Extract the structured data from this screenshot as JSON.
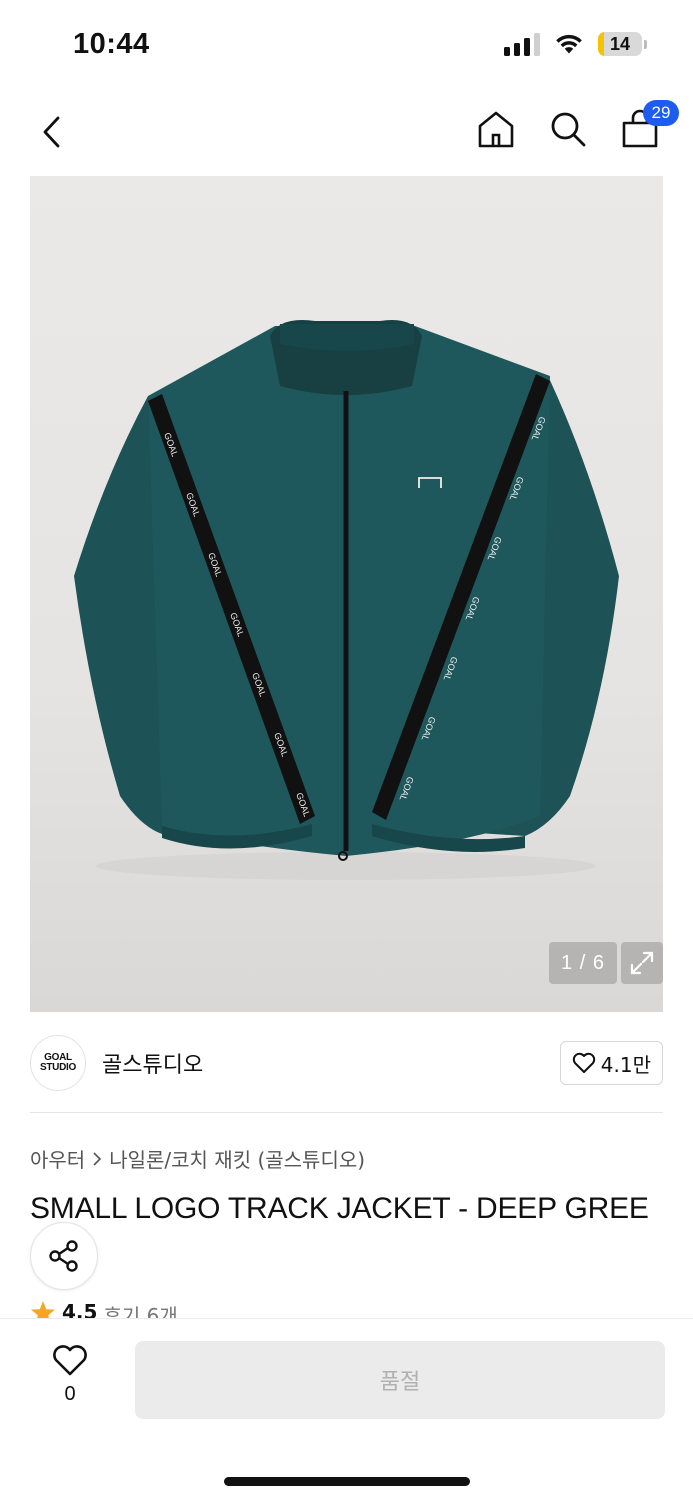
{
  "status_bar": {
    "time": "10:44",
    "battery_level": "14",
    "battery_fraction": 0.14,
    "battery_color": "#f5c400"
  },
  "nav": {
    "back_icon": "chevron-left-icon",
    "home_icon": "home-icon",
    "search_icon": "search-icon",
    "cart_icon": "shopping-bag-icon",
    "cart_count": "29",
    "badge_color": "#1e5bf0"
  },
  "product_image": {
    "counter": "1 / 6",
    "expand_icon": "expand-icon",
    "jacket_color": "#1d5256"
  },
  "brand": {
    "logo_line1": "GOAL",
    "logo_line2": "STUDIO",
    "name": "골스튜디오",
    "like_count": "4.1만"
  },
  "product": {
    "breadcrumb": [
      "아우터",
      "나일론/코치 재킷 (골스튜디오)"
    ],
    "title": "SMALL LOGO TRACK JACKET - DEEP GREE",
    "share_icon": "share-icon",
    "rating": "4.5",
    "review_text": "후기 6개"
  },
  "bottom_bar": {
    "wish_count": "0",
    "soldout_label": "품절"
  }
}
